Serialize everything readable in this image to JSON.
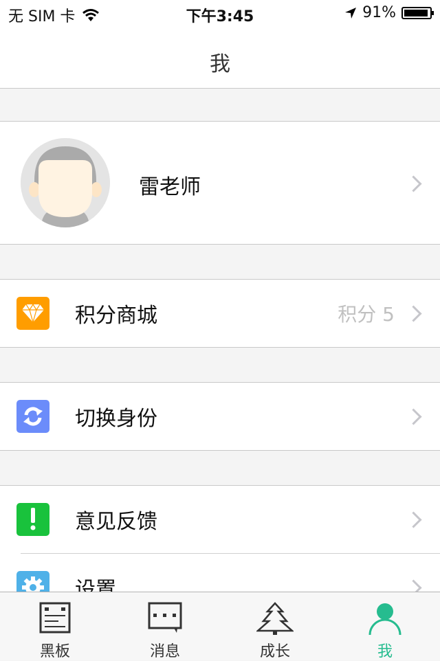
{
  "status_bar": {
    "carrier": "无 SIM 卡",
    "time": "下午3:45",
    "battery_percent_text": "91%",
    "battery_level": 0.91,
    "icons": [
      "wifi-icon",
      "location-arrow-icon",
      "battery-icon"
    ]
  },
  "nav": {
    "title": "我"
  },
  "profile": {
    "name": "雷老师",
    "avatar_icon": "default-avatar-icon"
  },
  "menu": [
    {
      "label": "积分商城",
      "value": "积分 5",
      "icon": "diamond-icon",
      "color": "#ff9d00"
    },
    {
      "label": "切换身份",
      "value": "",
      "icon": "refresh-icon",
      "color": "#6b8cfa"
    },
    {
      "label": "意见反馈",
      "value": "",
      "icon": "exclamation-icon",
      "color": "#19c23c"
    },
    {
      "label": "设置",
      "value": "",
      "icon": "gear-icon",
      "color": "#4fb1e8"
    }
  ],
  "tabbar": {
    "active_color": "#26bc8f",
    "items": [
      {
        "label": "黑板",
        "icon": "blackboard-icon",
        "active": false
      },
      {
        "label": "消息",
        "icon": "message-icon",
        "active": false
      },
      {
        "label": "成长",
        "icon": "tree-icon",
        "active": false
      },
      {
        "label": "我",
        "icon": "person-icon",
        "active": true
      }
    ]
  }
}
